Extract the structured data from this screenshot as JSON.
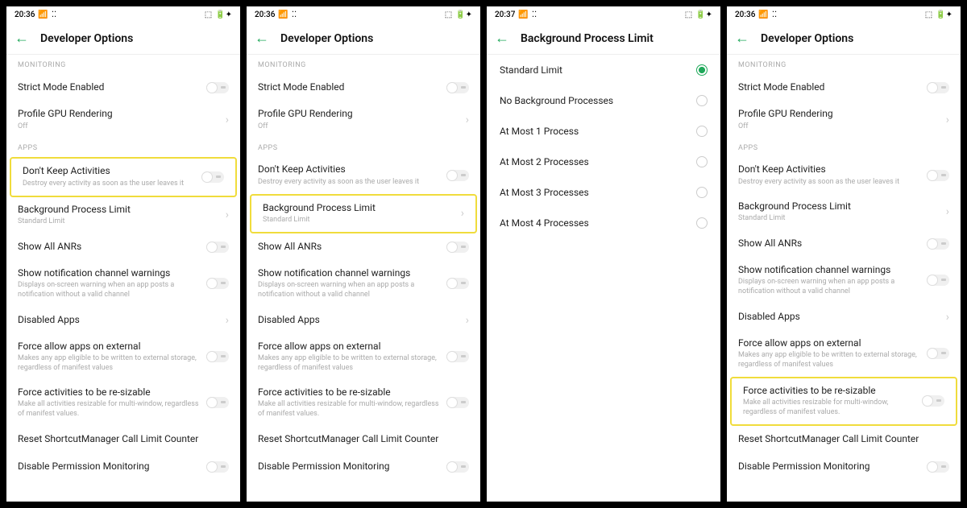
{
  "status": {
    "time1": "20:36",
    "time2": "20:37",
    "signal": "｜｜",
    "extra": "⁞⁞"
  },
  "battery_icons": "◫ ▢ ✦",
  "screens": [
    {
      "title": "Developer Options",
      "time": "20:36",
      "highlight": "dont_keep",
      "sections": [
        {
          "header": "MONITORING",
          "rows": [
            {
              "title": "Strict Mode Enabled",
              "type": "toggle"
            },
            {
              "title": "Profile GPU Rendering",
              "sub": "Off",
              "type": "nav"
            }
          ]
        },
        {
          "header": "APPS",
          "rows": [
            {
              "id": "dont_keep",
              "title": "Don't Keep Activities",
              "sub": "Destroy every activity as soon as the user leaves it",
              "type": "toggle"
            },
            {
              "title": "Background Process Limit",
              "sub": "Standard Limit",
              "type": "nav"
            },
            {
              "title": "Show All ANRs",
              "type": "toggle"
            },
            {
              "title": "Show notification channel warnings",
              "sub": "Displays on-screen warning when an app posts a notification without a valid channel",
              "type": "toggle"
            },
            {
              "title": "Disabled Apps",
              "type": "nav"
            },
            {
              "title": "Force allow apps on external",
              "sub": "Makes any app eligible to be written to external storage, regardless of manifest values",
              "type": "toggle"
            },
            {
              "title": "Force activities to be re-sizable",
              "sub": "Make all activities resizable for multi-window, regardless of manifest values.",
              "type": "toggle"
            },
            {
              "title": "Reset ShortcutManager Call Limit Counter",
              "type": "none"
            },
            {
              "title": "Disable Permission Monitoring",
              "type": "toggle"
            }
          ]
        }
      ]
    },
    {
      "title": "Developer Options",
      "time": "20:36",
      "highlight": "bg_limit",
      "sections": [
        {
          "header": "MONITORING",
          "rows": [
            {
              "title": "Strict Mode Enabled",
              "type": "toggle"
            },
            {
              "title": "Profile GPU Rendering",
              "sub": "Off",
              "type": "nav"
            }
          ]
        },
        {
          "header": "APPS",
          "rows": [
            {
              "title": "Don't Keep Activities",
              "sub": "Destroy every activity as soon as the user leaves it",
              "type": "toggle"
            },
            {
              "id": "bg_limit",
              "title": "Background Process Limit",
              "sub": "Standard Limit",
              "type": "nav"
            },
            {
              "title": "Show All ANRs",
              "type": "toggle"
            },
            {
              "title": "Show notification channel warnings",
              "sub": "Displays on-screen warning when an app posts a notification without a valid channel",
              "type": "toggle"
            },
            {
              "title": "Disabled Apps",
              "type": "nav"
            },
            {
              "title": "Force allow apps on external",
              "sub": "Makes any app eligible to be written to external storage, regardless of manifest values",
              "type": "toggle"
            },
            {
              "title": "Force activities to be re-sizable",
              "sub": "Make all activities resizable for multi-window, regardless of manifest values.",
              "type": "toggle"
            },
            {
              "title": "Reset ShortcutManager Call Limit Counter",
              "type": "none"
            },
            {
              "title": "Disable Permission Monitoring",
              "type": "toggle"
            }
          ]
        }
      ]
    },
    {
      "title": "Background Process Limit",
      "time": "20:37",
      "options": [
        {
          "label": "Standard Limit",
          "selected": true
        },
        {
          "label": "No Background Processes",
          "selected": false
        },
        {
          "label": "At Most 1 Process",
          "selected": false
        },
        {
          "label": "At Most 2 Processes",
          "selected": false
        },
        {
          "label": "At Most 3 Processes",
          "selected": false
        },
        {
          "label": "At Most 4 Processes",
          "selected": false
        }
      ]
    },
    {
      "title": "Developer Options",
      "time": "20:36",
      "highlight": "force_resize",
      "sections": [
        {
          "header": "MONITORING",
          "rows": [
            {
              "title": "Strict Mode Enabled",
              "type": "toggle"
            },
            {
              "title": "Profile GPU Rendering",
              "sub": "Off",
              "type": "nav"
            }
          ]
        },
        {
          "header": "APPS",
          "rows": [
            {
              "title": "Don't Keep Activities",
              "sub": "Destroy every activity as soon as the user leaves it",
              "type": "toggle"
            },
            {
              "title": "Background Process Limit",
              "sub": "Standard Limit",
              "type": "nav"
            },
            {
              "title": "Show All ANRs",
              "type": "toggle"
            },
            {
              "title": "Show notification channel warnings",
              "sub": "Displays on-screen warning when an app posts a notification without a valid channel",
              "type": "toggle"
            },
            {
              "title": "Disabled Apps",
              "type": "nav"
            },
            {
              "title": "Force allow apps on external",
              "sub": "Makes any app eligible to be written to external storage, regardless of manifest values",
              "type": "toggle"
            },
            {
              "id": "force_resize",
              "title": "Force activities to be re-sizable",
              "sub": "Make all activities resizable for multi-window, regardless of manifest values.",
              "type": "toggle"
            },
            {
              "title": "Reset ShortcutManager Call Limit Counter",
              "type": "none"
            },
            {
              "title": "Disable Permission Monitoring",
              "type": "toggle"
            }
          ]
        }
      ]
    }
  ]
}
